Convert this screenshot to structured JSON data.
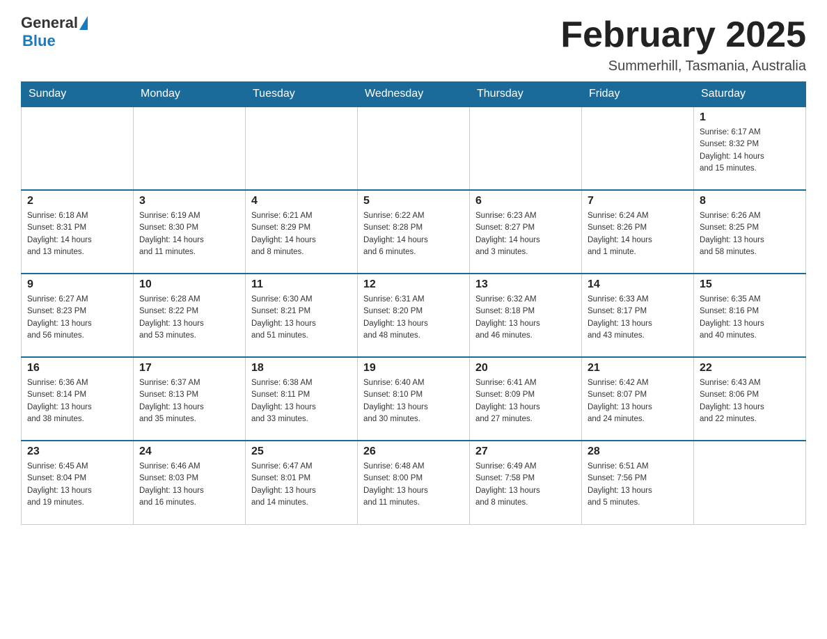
{
  "header": {
    "logo_general": "General",
    "logo_blue": "Blue",
    "month_title": "February 2025",
    "location": "Summerhill, Tasmania, Australia"
  },
  "weekdays": [
    "Sunday",
    "Monday",
    "Tuesday",
    "Wednesday",
    "Thursday",
    "Friday",
    "Saturday"
  ],
  "weeks": [
    [
      {
        "day": "",
        "info": ""
      },
      {
        "day": "",
        "info": ""
      },
      {
        "day": "",
        "info": ""
      },
      {
        "day": "",
        "info": ""
      },
      {
        "day": "",
        "info": ""
      },
      {
        "day": "",
        "info": ""
      },
      {
        "day": "1",
        "info": "Sunrise: 6:17 AM\nSunset: 8:32 PM\nDaylight: 14 hours\nand 15 minutes."
      }
    ],
    [
      {
        "day": "2",
        "info": "Sunrise: 6:18 AM\nSunset: 8:31 PM\nDaylight: 14 hours\nand 13 minutes."
      },
      {
        "day": "3",
        "info": "Sunrise: 6:19 AM\nSunset: 8:30 PM\nDaylight: 14 hours\nand 11 minutes."
      },
      {
        "day": "4",
        "info": "Sunrise: 6:21 AM\nSunset: 8:29 PM\nDaylight: 14 hours\nand 8 minutes."
      },
      {
        "day": "5",
        "info": "Sunrise: 6:22 AM\nSunset: 8:28 PM\nDaylight: 14 hours\nand 6 minutes."
      },
      {
        "day": "6",
        "info": "Sunrise: 6:23 AM\nSunset: 8:27 PM\nDaylight: 14 hours\nand 3 minutes."
      },
      {
        "day": "7",
        "info": "Sunrise: 6:24 AM\nSunset: 8:26 PM\nDaylight: 14 hours\nand 1 minute."
      },
      {
        "day": "8",
        "info": "Sunrise: 6:26 AM\nSunset: 8:25 PM\nDaylight: 13 hours\nand 58 minutes."
      }
    ],
    [
      {
        "day": "9",
        "info": "Sunrise: 6:27 AM\nSunset: 8:23 PM\nDaylight: 13 hours\nand 56 minutes."
      },
      {
        "day": "10",
        "info": "Sunrise: 6:28 AM\nSunset: 8:22 PM\nDaylight: 13 hours\nand 53 minutes."
      },
      {
        "day": "11",
        "info": "Sunrise: 6:30 AM\nSunset: 8:21 PM\nDaylight: 13 hours\nand 51 minutes."
      },
      {
        "day": "12",
        "info": "Sunrise: 6:31 AM\nSunset: 8:20 PM\nDaylight: 13 hours\nand 48 minutes."
      },
      {
        "day": "13",
        "info": "Sunrise: 6:32 AM\nSunset: 8:18 PM\nDaylight: 13 hours\nand 46 minutes."
      },
      {
        "day": "14",
        "info": "Sunrise: 6:33 AM\nSunset: 8:17 PM\nDaylight: 13 hours\nand 43 minutes."
      },
      {
        "day": "15",
        "info": "Sunrise: 6:35 AM\nSunset: 8:16 PM\nDaylight: 13 hours\nand 40 minutes."
      }
    ],
    [
      {
        "day": "16",
        "info": "Sunrise: 6:36 AM\nSunset: 8:14 PM\nDaylight: 13 hours\nand 38 minutes."
      },
      {
        "day": "17",
        "info": "Sunrise: 6:37 AM\nSunset: 8:13 PM\nDaylight: 13 hours\nand 35 minutes."
      },
      {
        "day": "18",
        "info": "Sunrise: 6:38 AM\nSunset: 8:11 PM\nDaylight: 13 hours\nand 33 minutes."
      },
      {
        "day": "19",
        "info": "Sunrise: 6:40 AM\nSunset: 8:10 PM\nDaylight: 13 hours\nand 30 minutes."
      },
      {
        "day": "20",
        "info": "Sunrise: 6:41 AM\nSunset: 8:09 PM\nDaylight: 13 hours\nand 27 minutes."
      },
      {
        "day": "21",
        "info": "Sunrise: 6:42 AM\nSunset: 8:07 PM\nDaylight: 13 hours\nand 24 minutes."
      },
      {
        "day": "22",
        "info": "Sunrise: 6:43 AM\nSunset: 8:06 PM\nDaylight: 13 hours\nand 22 minutes."
      }
    ],
    [
      {
        "day": "23",
        "info": "Sunrise: 6:45 AM\nSunset: 8:04 PM\nDaylight: 13 hours\nand 19 minutes."
      },
      {
        "day": "24",
        "info": "Sunrise: 6:46 AM\nSunset: 8:03 PM\nDaylight: 13 hours\nand 16 minutes."
      },
      {
        "day": "25",
        "info": "Sunrise: 6:47 AM\nSunset: 8:01 PM\nDaylight: 13 hours\nand 14 minutes."
      },
      {
        "day": "26",
        "info": "Sunrise: 6:48 AM\nSunset: 8:00 PM\nDaylight: 13 hours\nand 11 minutes."
      },
      {
        "day": "27",
        "info": "Sunrise: 6:49 AM\nSunset: 7:58 PM\nDaylight: 13 hours\nand 8 minutes."
      },
      {
        "day": "28",
        "info": "Sunrise: 6:51 AM\nSunset: 7:56 PM\nDaylight: 13 hours\nand 5 minutes."
      },
      {
        "day": "",
        "info": ""
      }
    ]
  ]
}
